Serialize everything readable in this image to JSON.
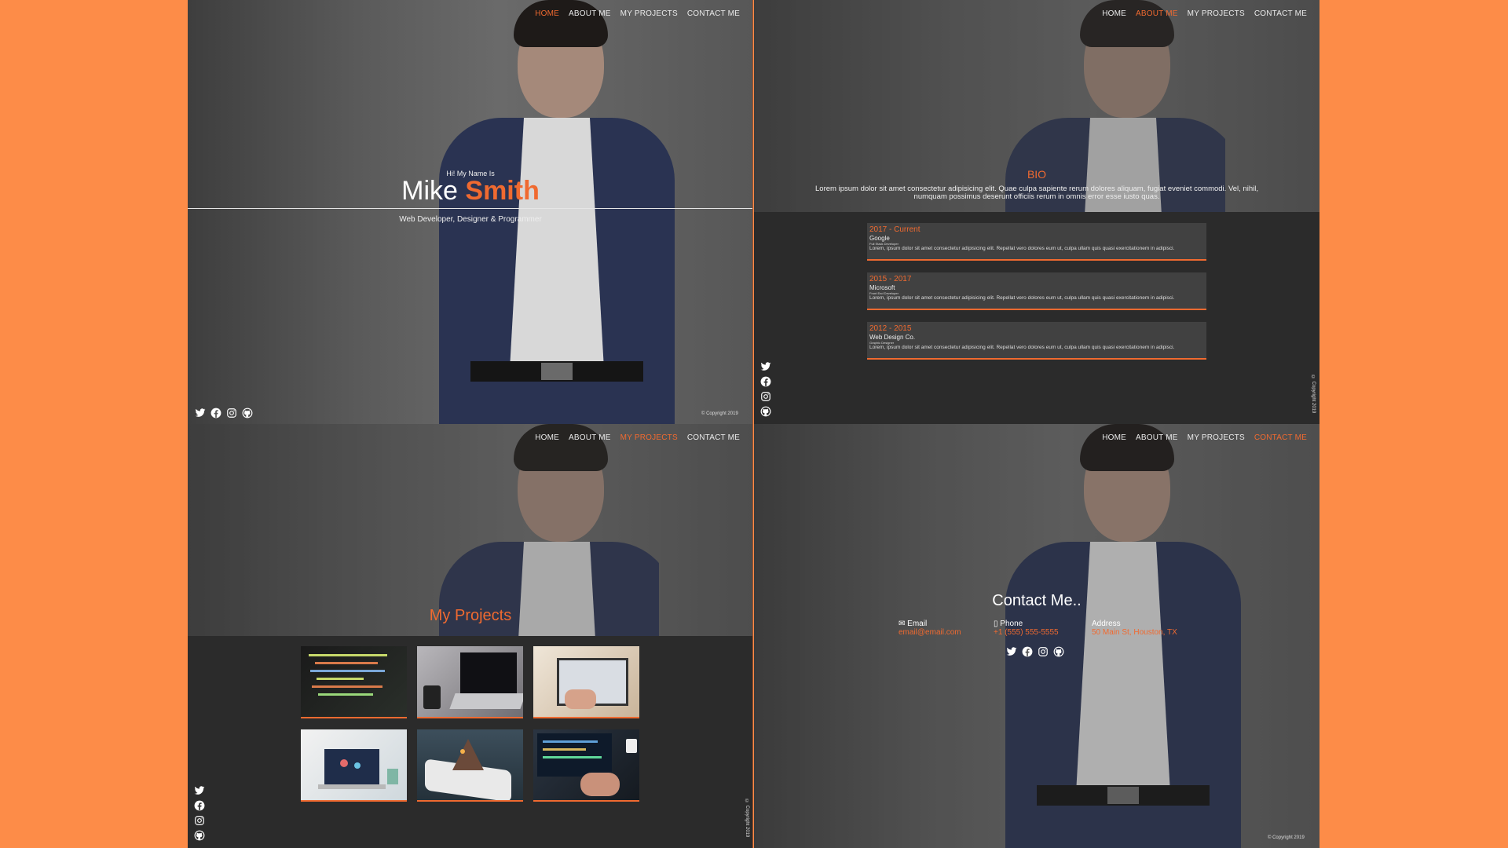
{
  "colors": {
    "accent": "#f06a30",
    "background": "#fd8c48",
    "dark_panel": "#2b2b2b",
    "card": "#414141"
  },
  "nav": {
    "home": "HOME",
    "about": "ABOUT ME",
    "projects": "MY PROJECTS",
    "contact": "CONTACT ME"
  },
  "icons": [
    "twitter-icon",
    "facebook-icon",
    "instagram-icon",
    "github-icon"
  ],
  "copyright": "© Copyright 2019",
  "home": {
    "greeting": "Hi! My Name Is",
    "first_name": "Mike",
    "last_name": "Smith",
    "tagline": "Web Developer, Designer & Programmer",
    "active_nav": "HOME"
  },
  "about": {
    "active_nav": "ABOUT ME",
    "title": "BIO",
    "text": "Lorem ipsum dolor sit amet consectetur adipisicing elit. Quae culpa sapiente rerum dolores aliquam, fugiat eveniet commodi. Vel, nihil, numquam possimus deserunt officiis rerum in omnis error esse iusto quas.",
    "jobs": [
      {
        "years": "2017 - Current",
        "company": "Google",
        "role": "Full Stack Developer",
        "desc": "Lorem, ipsum dolor sit amet consectetur adipisicing elit. Repellat vero dolores eum ut, culpa ullam quis quasi exercitationem in adipisci."
      },
      {
        "years": "2015 - 2017",
        "company": "Microsoft",
        "role": "Front End Developer",
        "desc": "Lorem, ipsum dolor sit amet consectetur adipisicing elit. Repellat vero dolores eum ut, culpa ullam quis quasi exercitationem in adipisci."
      },
      {
        "years": "2012 - 2015",
        "company": "Web Design Co.",
        "role": "Graphic Designer",
        "desc": "Lorem, ipsum dolor sit amet consectetur adipisicing elit. Repellat vero dolores eum ut, culpa ullam quis quasi exercitationem in adipisci."
      }
    ]
  },
  "projects": {
    "active_nav": "MY PROJECTS",
    "title": "My Projects"
  },
  "contact": {
    "active_nav": "CONTACT ME",
    "title": "Contact Me..",
    "email_label": "Email",
    "email_value": "email@email.com",
    "phone_label": "Phone",
    "phone_value": "+1 (555) 555-5555",
    "address_label": "Address",
    "address_value": "50 Main St, Houston, TX"
  }
}
